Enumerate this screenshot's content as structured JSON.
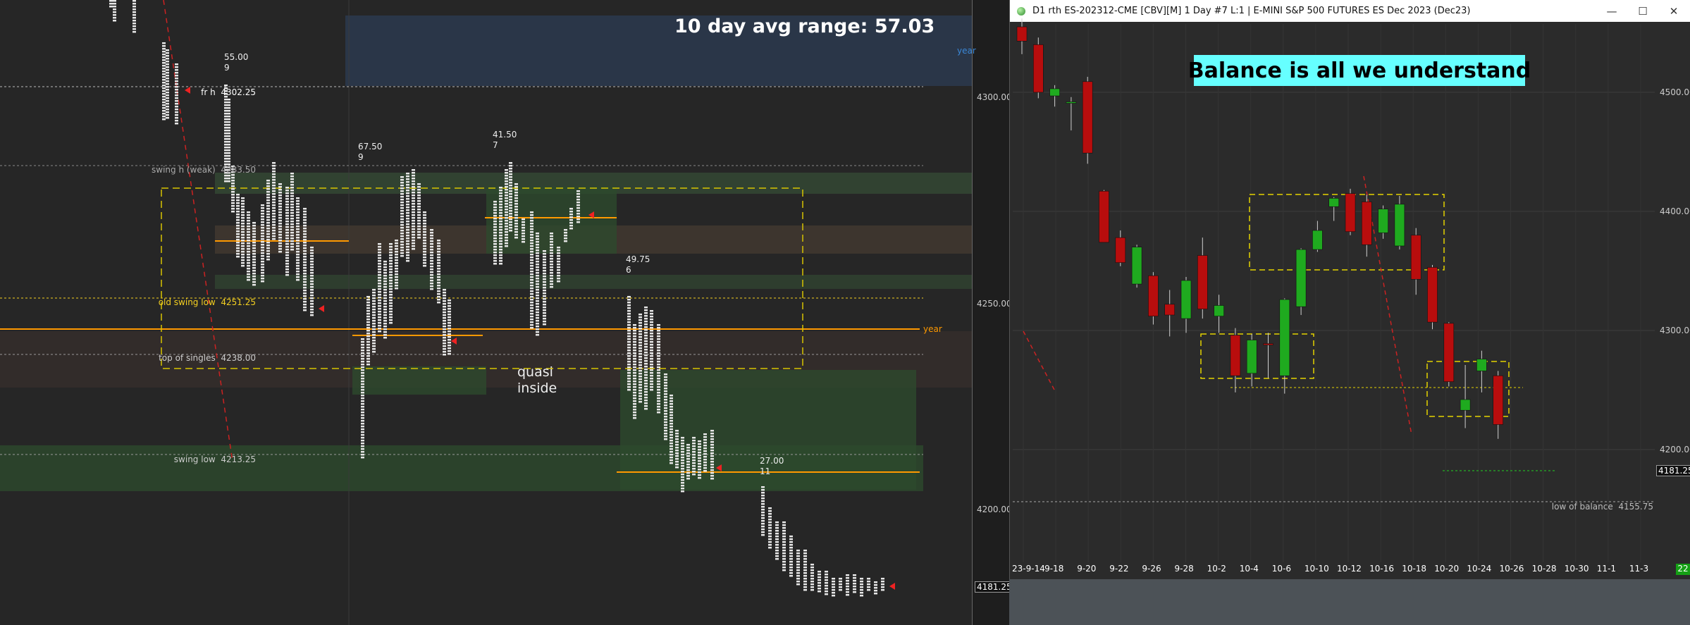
{
  "left_chart": {
    "headline": "10 day avg range:  57.03",
    "levels": [
      {
        "label": "fr h",
        "price": "4302.25",
        "color": "#ffffff"
      },
      {
        "label": "swing h (weak)",
        "price": "4283.50",
        "color": "#aaaaaa"
      },
      {
        "label": "old swing low",
        "price": "4251.25",
        "color": "#f5d020"
      },
      {
        "label": "year",
        "price": "",
        "color": "#ff9900"
      },
      {
        "label": "top of singles",
        "price": "4238.00",
        "color": "#cccccc"
      },
      {
        "label": "swing low",
        "price": "4213.25",
        "color": "#cccccc"
      }
    ],
    "year_label_top": "year",
    "price_ticks": [
      "4300.00",
      "4250.00",
      "4200.00"
    ],
    "current_price": "4181.25",
    "annotation": "quasi\ninside",
    "profile_labels": [
      {
        "value": "55.00",
        "count": "9"
      },
      {
        "value": "67.50",
        "count": "9"
      },
      {
        "value": "41.50",
        "count": "7"
      },
      {
        "value": "49.75",
        "count": "6"
      },
      {
        "value": "27.00",
        "count": "11"
      }
    ]
  },
  "right_window": {
    "title": "D1 rth ES-202312-CME [CBV][M]  1 Day  #7 L:1 | E-MINI S&P 500 FUTURES ES Dec 2023 (Dec23)",
    "controls": {
      "minimize": "—",
      "maximize": "☐",
      "close": "✕"
    },
    "banner": "Balance is all we understand",
    "price_ticks": [
      "4500.00",
      "4400.00",
      "4300.00",
      "4200.00"
    ],
    "current_price": "4181.25",
    "low_of_balance_label": "low of balance",
    "low_of_balance_price": "4155.75",
    "bars_count": "22",
    "colors": {
      "up": "#1faa1f",
      "down": "#b80d0d",
      "box": "#e5d300"
    }
  },
  "chart_data": {
    "type": "candlestick",
    "title": "Balance is all we understand",
    "xlabel": "",
    "ylabel": "",
    "x_ticks": [
      "23-9-14",
      "9-18",
      "9-20",
      "9-22",
      "9-26",
      "9-28",
      "10-2",
      "10-4",
      "10-6",
      "10-10",
      "10-12",
      "10-16",
      "10-18",
      "10-20",
      "10-24",
      "10-26",
      "10-28",
      "10-30",
      "11-1",
      "11-3"
    ],
    "ylim": [
      4105,
      4565
    ],
    "candles": [
      {
        "date": "9-14",
        "o": 4555,
        "h": 4562,
        "l": 4532,
        "c": 4543
      },
      {
        "date": "9-15",
        "o": 4540,
        "h": 4546,
        "l": 4495,
        "c": 4500
      },
      {
        "date": "9-18",
        "o": 4497,
        "h": 4506,
        "l": 4488,
        "c": 4503
      },
      {
        "date": "9-19",
        "o": 4491,
        "h": 4496,
        "l": 4468,
        "c": 4492
      },
      {
        "date": "9-20",
        "o": 4509,
        "h": 4513,
        "l": 4440,
        "c": 4449
      },
      {
        "date": "9-21",
        "o": 4417,
        "h": 4418,
        "l": 4374,
        "c": 4374
      },
      {
        "date": "9-22",
        "o": 4378,
        "h": 4384,
        "l": 4354,
        "c": 4357
      },
      {
        "date": "9-25",
        "o": 4339,
        "h": 4372,
        "l": 4336,
        "c": 4370
      },
      {
        "date": "9-26",
        "o": 4346,
        "h": 4349,
        "l": 4305,
        "c": 4312
      },
      {
        "date": "9-27",
        "o": 4322,
        "h": 4334,
        "l": 4295,
        "c": 4313
      },
      {
        "date": "9-28",
        "o": 4310,
        "h": 4345,
        "l": 4298,
        "c": 4342
      },
      {
        "date": "9-29",
        "o": 4363,
        "h": 4378,
        "l": 4310,
        "c": 4318
      },
      {
        "date": "10-2",
        "o": 4312,
        "h": 4330,
        "l": 4298,
        "c": 4321
      },
      {
        "date": "10-3",
        "o": 4296,
        "h": 4302,
        "l": 4248,
        "c": 4262
      },
      {
        "date": "10-4",
        "o": 4264,
        "h": 4297,
        "l": 4253,
        "c": 4292
      },
      {
        "date": "10-5",
        "o": 4289,
        "h": 4298,
        "l": 4260,
        "c": 4288
      },
      {
        "date": "10-6",
        "o": 4262,
        "h": 4327,
        "l": 4247,
        "c": 4326
      },
      {
        "date": "10-9",
        "o": 4320,
        "h": 4369,
        "l": 4313,
        "c": 4368
      },
      {
        "date": "10-10",
        "o": 4368,
        "h": 4392,
        "l": 4366,
        "c": 4384
      },
      {
        "date": "10-11",
        "o": 4404,
        "h": 4412,
        "l": 4392,
        "c": 4411
      },
      {
        "date": "10-12",
        "o": 4415,
        "h": 4419,
        "l": 4380,
        "c": 4383
      },
      {
        "date": "10-13",
        "o": 4408,
        "h": 4414,
        "l": 4362,
        "c": 4372
      },
      {
        "date": "10-16",
        "o": 4382,
        "h": 4405,
        "l": 4377,
        "c": 4402
      },
      {
        "date": "10-17",
        "o": 4371,
        "h": 4413,
        "l": 4368,
        "c": 4406
      },
      {
        "date": "10-18",
        "o": 4380,
        "h": 4386,
        "l": 4330,
        "c": 4343
      },
      {
        "date": "10-19",
        "o": 4353,
        "h": 4355,
        "l": 4301,
        "c": 4307
      },
      {
        "date": "10-20",
        "o": 4306,
        "h": 4307,
        "l": 4253,
        "c": 4257
      },
      {
        "date": "10-23",
        "o": 4233,
        "h": 4271,
        "l": 4218,
        "c": 4242
      },
      {
        "date": "10-24",
        "o": 4266,
        "h": 4283,
        "l": 4248,
        "c": 4276
      },
      {
        "date": "10-25",
        "o": 4262,
        "h": 4266,
        "l": 4209,
        "c": 4221
      }
    ]
  }
}
